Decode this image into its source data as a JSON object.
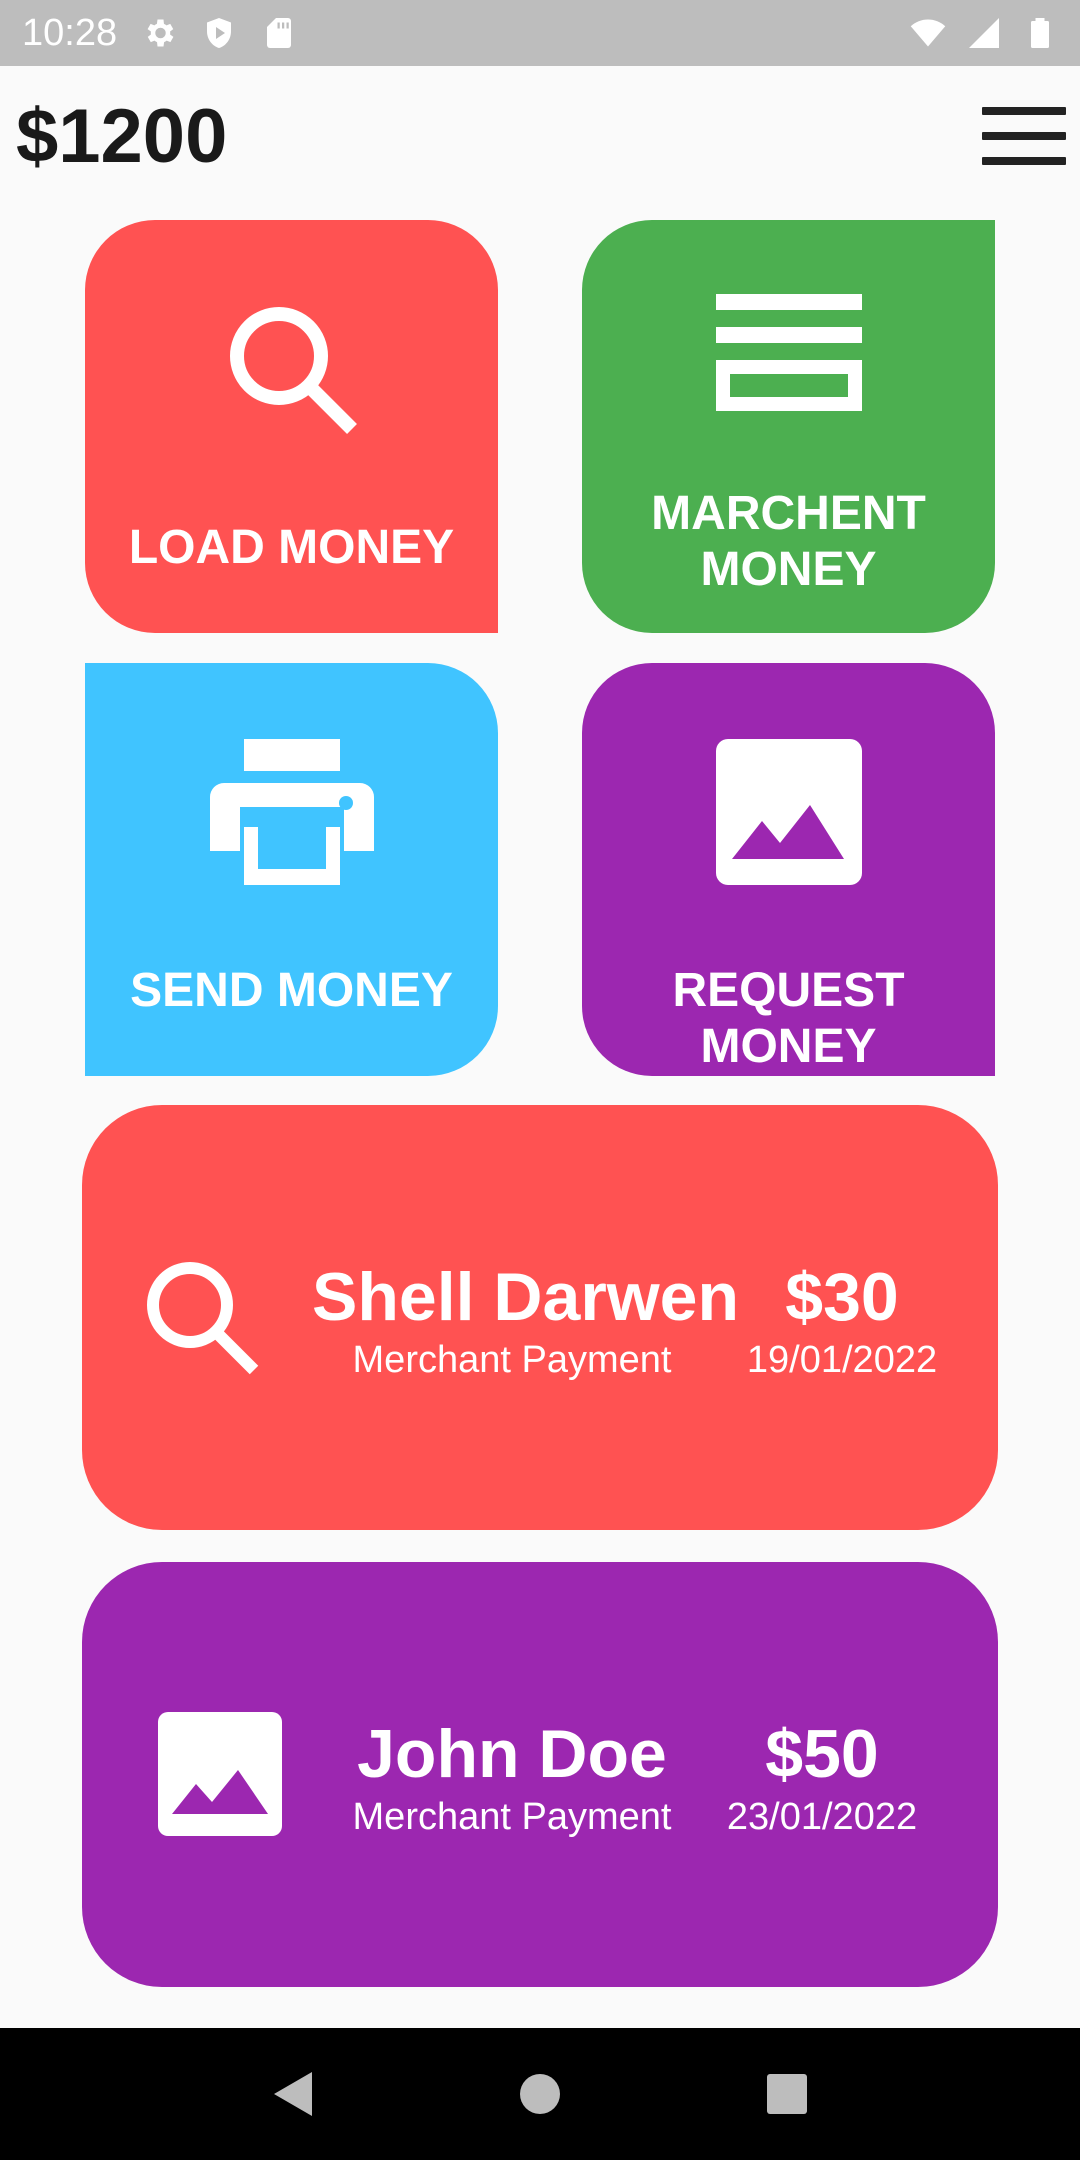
{
  "status_bar": {
    "time": "10:28",
    "left_icons": [
      "gear-icon",
      "play-protect-icon",
      "sd-card-icon"
    ],
    "right_icons": [
      "wifi-icon",
      "signal-icon",
      "battery-icon"
    ]
  },
  "header": {
    "balance": "$1200",
    "menu_icon": "hamburger-menu-icon"
  },
  "tiles": [
    {
      "label": "LOAD MONEY",
      "icon": "search-icon",
      "color": "#ff5252"
    },
    {
      "label_line1": "MARCHENT",
      "label_line2": "MONEY",
      "icon": "list-icon",
      "color": "#4caf50"
    },
    {
      "label": "SEND MONEY",
      "icon": "printer-icon",
      "color": "#40c4ff"
    },
    {
      "label": "REQUEST MONEY",
      "icon": "image-icon",
      "color": "#9c27b0"
    }
  ],
  "transactions": [
    {
      "name": "Shell Darwen",
      "type": "Merchant Payment",
      "amount": "$30",
      "date": "19/01/2022",
      "icon": "search-icon",
      "color": "#ff5252"
    },
    {
      "name": "John Doe",
      "type": "Merchant Payment",
      "amount": "$50",
      "date": "23/01/2022",
      "icon": "image-icon",
      "color": "#9c27b0"
    }
  ],
  "nav_bar": {
    "buttons": [
      "back-icon",
      "home-icon",
      "recents-icon"
    ]
  }
}
